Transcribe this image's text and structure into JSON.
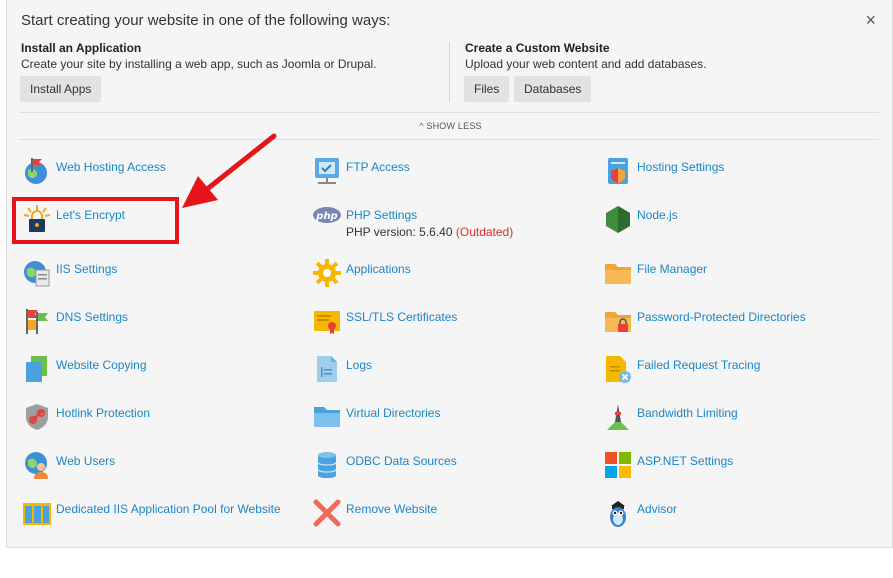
{
  "header": {
    "title": "Start creating your website in one of the following ways:",
    "close_glyph": "×"
  },
  "install_app": {
    "title": "Install an Application",
    "description": "Create your site by installing a web app, such as Joomla or Drupal.",
    "button": "Install Apps"
  },
  "custom_site": {
    "title": "Create a Custom Website",
    "description": "Upload your web content and add databases.",
    "buttons": [
      "Files",
      "Databases"
    ]
  },
  "show_less": "SHOW LESS",
  "tools": [
    {
      "label": "Web Hosting Access",
      "icon": "globe-flag-icon"
    },
    {
      "label": "FTP Access",
      "icon": "ftp-icon"
    },
    {
      "label": "Hosting Settings",
      "icon": "hosting-settings-icon"
    },
    {
      "label": "Let's Encrypt",
      "icon": "lets-encrypt-icon"
    },
    {
      "label": "PHP Settings",
      "icon": "php-icon",
      "sub": "PHP version: 5.6.40",
      "sub_warn": "(Outdated)"
    },
    {
      "label": "Node.js",
      "icon": "nodejs-icon"
    },
    {
      "label": "IIS Settings",
      "icon": "iis-icon"
    },
    {
      "label": "Applications",
      "icon": "gear-icon"
    },
    {
      "label": "File Manager",
      "icon": "folder-icon"
    },
    {
      "label": "DNS Settings",
      "icon": "dns-icon"
    },
    {
      "label": "SSL/TLS Certificates",
      "icon": "certificate-icon"
    },
    {
      "label": "Password-Protected Directories",
      "icon": "locked-folder-icon"
    },
    {
      "label": "Website Copying",
      "icon": "copy-icon"
    },
    {
      "label": "Logs",
      "icon": "logs-icon"
    },
    {
      "label": "Failed Request Tracing",
      "icon": "failed-request-icon"
    },
    {
      "label": "Hotlink Protection",
      "icon": "hotlink-icon"
    },
    {
      "label": "Virtual Directories",
      "icon": "virtual-dir-icon"
    },
    {
      "label": "Bandwidth Limiting",
      "icon": "bandwidth-icon"
    },
    {
      "label": "Web Users",
      "icon": "web-users-icon"
    },
    {
      "label": "ODBC Data Sources",
      "icon": "database-icon"
    },
    {
      "label": "ASP.NET Settings",
      "icon": "aspnet-icon"
    },
    {
      "label": "Dedicated IIS Application Pool for Website",
      "icon": "app-pool-icon"
    },
    {
      "label": "Remove Website",
      "icon": "remove-icon"
    },
    {
      "label": "Advisor",
      "icon": "advisor-icon"
    }
  ],
  "colors": {
    "link": "#1a86c8",
    "highlight": "#e5151a",
    "outdated": "#d0332b"
  }
}
